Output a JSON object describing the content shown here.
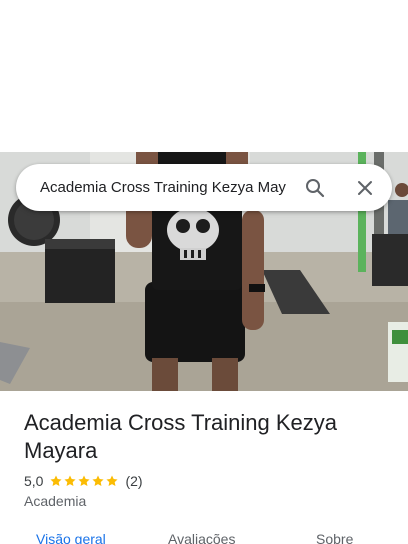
{
  "search": {
    "query": "Academia Cross Training Kezya May"
  },
  "icons": {
    "search": "search-icon",
    "close": "close-icon",
    "star": "star-icon"
  },
  "place": {
    "title": "Academia Cross Training Kezya Mayara",
    "rating": "5,0",
    "stars_filled": 5,
    "review_count": "(2)",
    "category": "Academia"
  },
  "tabs": [
    {
      "label": "Visão geral",
      "active": true
    },
    {
      "label": "Avaliações",
      "active": false
    },
    {
      "label": "Sobre",
      "active": false
    }
  ],
  "colors": {
    "accent": "#1a73e8",
    "star": "#fbbc04"
  }
}
